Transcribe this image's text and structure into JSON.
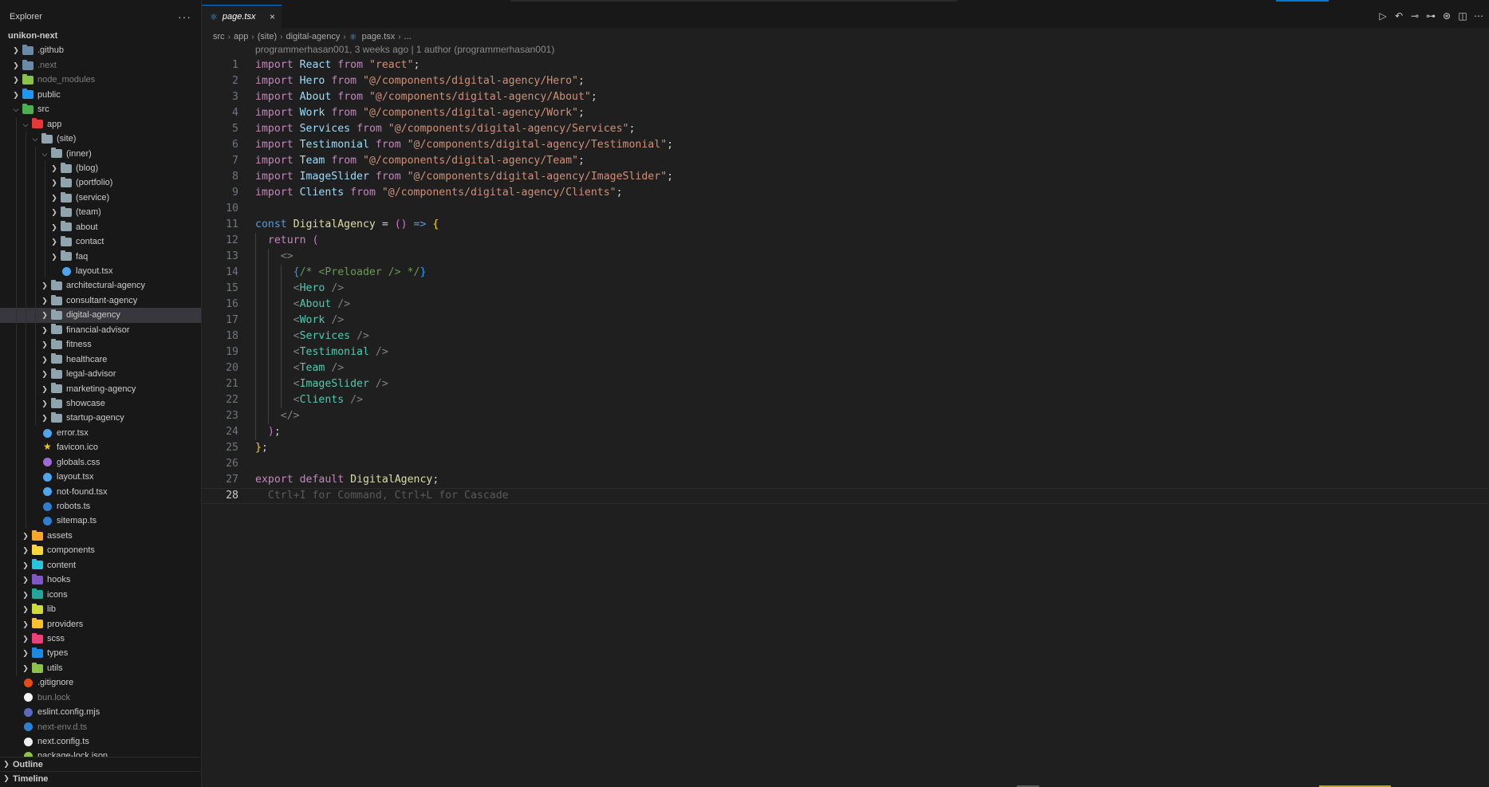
{
  "explorer": {
    "title": "Explorer",
    "more": "···",
    "tree": [
      {
        "label": "unikon-next",
        "depth": 0,
        "type": "root",
        "expanded": true
      },
      {
        "label": ".github",
        "depth": 1,
        "type": "folder",
        "color": "#6b8aa8",
        "expanded": false
      },
      {
        "label": ".next",
        "depth": 1,
        "type": "folder",
        "color": "#6b8aa8",
        "expanded": false,
        "dim": true
      },
      {
        "label": "node_modules",
        "depth": 1,
        "type": "folder",
        "color": "#8bc34a",
        "expanded": false,
        "dim": true
      },
      {
        "label": "public",
        "depth": 1,
        "type": "folder",
        "color": "#2196f3",
        "expanded": false
      },
      {
        "label": "src",
        "depth": 1,
        "type": "folder",
        "color": "#4caf50",
        "expanded": true
      },
      {
        "label": "app",
        "depth": 2,
        "type": "folder",
        "color": "#e53935",
        "expanded": true
      },
      {
        "label": "(site)",
        "depth": 3,
        "type": "folder",
        "color": "#90a4ae",
        "expanded": true
      },
      {
        "label": "(inner)",
        "depth": 4,
        "type": "folder",
        "color": "#90a4ae",
        "expanded": true
      },
      {
        "label": "(blog)",
        "depth": 5,
        "type": "folder",
        "color": "#90a4ae",
        "expanded": false
      },
      {
        "label": "(portfolio)",
        "depth": 5,
        "type": "folder",
        "color": "#90a4ae",
        "expanded": false
      },
      {
        "label": "(service)",
        "depth": 5,
        "type": "folder",
        "color": "#90a4ae",
        "expanded": false
      },
      {
        "label": "(team)",
        "depth": 5,
        "type": "folder",
        "color": "#90a4ae",
        "expanded": false
      },
      {
        "label": "about",
        "depth": 5,
        "type": "folder",
        "color": "#90a4ae",
        "expanded": false
      },
      {
        "label": "contact",
        "depth": 5,
        "type": "folder",
        "color": "#90a4ae",
        "expanded": false
      },
      {
        "label": "faq",
        "depth": 5,
        "type": "folder",
        "color": "#90a4ae",
        "expanded": false
      },
      {
        "label": "layout.tsx",
        "depth": 5,
        "type": "file",
        "color": "#4fa6ed"
      },
      {
        "label": "architectural-agency",
        "depth": 4,
        "type": "folder",
        "color": "#90a4ae",
        "expanded": false
      },
      {
        "label": "consultant-agency",
        "depth": 4,
        "type": "folder",
        "color": "#90a4ae",
        "expanded": false
      },
      {
        "label": "digital-agency",
        "depth": 4,
        "type": "folder",
        "color": "#90a4ae",
        "expanded": false,
        "selected": true
      },
      {
        "label": "financial-advisor",
        "depth": 4,
        "type": "folder",
        "color": "#90a4ae",
        "expanded": false
      },
      {
        "label": "fitness",
        "depth": 4,
        "type": "folder",
        "color": "#90a4ae",
        "expanded": false
      },
      {
        "label": "healthcare",
        "depth": 4,
        "type": "folder",
        "color": "#90a4ae",
        "expanded": false
      },
      {
        "label": "legal-advisor",
        "depth": 4,
        "type": "folder",
        "color": "#90a4ae",
        "expanded": false
      },
      {
        "label": "marketing-agency",
        "depth": 4,
        "type": "folder",
        "color": "#90a4ae",
        "expanded": false
      },
      {
        "label": "showcase",
        "depth": 4,
        "type": "folder",
        "color": "#90a4ae",
        "expanded": false
      },
      {
        "label": "startup-agency",
        "depth": 4,
        "type": "folder",
        "color": "#90a4ae",
        "expanded": false
      },
      {
        "label": "error.tsx",
        "depth": 3,
        "type": "file",
        "color": "#4fa6ed"
      },
      {
        "label": "favicon.ico",
        "depth": 3,
        "type": "star",
        "color": "#f2c511"
      },
      {
        "label": "globals.css",
        "depth": 3,
        "type": "file",
        "color": "#9c6ad6"
      },
      {
        "label": "layout.tsx",
        "depth": 3,
        "type": "file",
        "color": "#4fa6ed"
      },
      {
        "label": "not-found.tsx",
        "depth": 3,
        "type": "file",
        "color": "#4fa6ed"
      },
      {
        "label": "robots.ts",
        "depth": 3,
        "type": "file",
        "color": "#2f7fd1"
      },
      {
        "label": "sitemap.ts",
        "depth": 3,
        "type": "file",
        "color": "#2f7fd1"
      },
      {
        "label": "assets",
        "depth": 2,
        "type": "folder",
        "color": "#f9a825",
        "expanded": false
      },
      {
        "label": "components",
        "depth": 2,
        "type": "folder",
        "color": "#fdd835",
        "expanded": false
      },
      {
        "label": "content",
        "depth": 2,
        "type": "folder",
        "color": "#26c6da",
        "expanded": false
      },
      {
        "label": "hooks",
        "depth": 2,
        "type": "folder",
        "color": "#7e57c2",
        "expanded": false
      },
      {
        "label": "icons",
        "depth": 2,
        "type": "folder",
        "color": "#26a69a",
        "expanded": false
      },
      {
        "label": "lib",
        "depth": 2,
        "type": "folder",
        "color": "#cddc39",
        "expanded": false
      },
      {
        "label": "providers",
        "depth": 2,
        "type": "folder",
        "color": "#fbc02d",
        "expanded": false
      },
      {
        "label": "scss",
        "depth": 2,
        "type": "folder",
        "color": "#ec407a",
        "expanded": false
      },
      {
        "label": "types",
        "depth": 2,
        "type": "folder",
        "color": "#1e88e5",
        "expanded": false
      },
      {
        "label": "utils",
        "depth": 2,
        "type": "folder",
        "color": "#8bc34a",
        "expanded": false
      },
      {
        "label": ".gitignore",
        "depth": 1,
        "type": "file",
        "color": "#e64a19"
      },
      {
        "label": "bun.lock",
        "depth": 1,
        "type": "file",
        "color": "#f5f5f5",
        "dim": true
      },
      {
        "label": "eslint.config.mjs",
        "depth": 1,
        "type": "file",
        "color": "#5c6bc0"
      },
      {
        "label": "next-env.d.ts",
        "depth": 1,
        "type": "file",
        "color": "#2f7fd1",
        "dim": true
      },
      {
        "label": "next.config.ts",
        "depth": 1,
        "type": "file",
        "color": "#eeeeee"
      },
      {
        "label": "package-lock.json",
        "depth": 1,
        "type": "file",
        "color": "#8bc34a"
      }
    ],
    "panels": {
      "outline": "Outline",
      "timeline": "Timeline"
    }
  },
  "tab": {
    "label": "page.tsx",
    "close": "×"
  },
  "breadcrumb": [
    "src",
    "app",
    "(site)",
    "digital-agency",
    "page.tsx",
    "..."
  ],
  "blame": "programmerhasan001, 3 weeks ago | 1 author (programmerhasan001)",
  "code": [
    [
      [
        "kw",
        "import"
      ],
      [
        "pun",
        " "
      ],
      [
        "id",
        "React"
      ],
      [
        "pun",
        " "
      ],
      [
        "kw",
        "from"
      ],
      [
        "pun",
        " "
      ],
      [
        "str",
        "\"react\""
      ],
      [
        "pun",
        ";"
      ]
    ],
    [
      [
        "kw",
        "import"
      ],
      [
        "pun",
        " "
      ],
      [
        "id",
        "Hero"
      ],
      [
        "pun",
        " "
      ],
      [
        "kw",
        "from"
      ],
      [
        "pun",
        " "
      ],
      [
        "str",
        "\"@/components/digital-agency/Hero\""
      ],
      [
        "pun",
        ";"
      ]
    ],
    [
      [
        "kw",
        "import"
      ],
      [
        "pun",
        " "
      ],
      [
        "id",
        "About"
      ],
      [
        "pun",
        " "
      ],
      [
        "kw",
        "from"
      ],
      [
        "pun",
        " "
      ],
      [
        "str",
        "\"@/components/digital-agency/About\""
      ],
      [
        "pun",
        ";"
      ]
    ],
    [
      [
        "kw",
        "import"
      ],
      [
        "pun",
        " "
      ],
      [
        "id",
        "Work"
      ],
      [
        "pun",
        " "
      ],
      [
        "kw",
        "from"
      ],
      [
        "pun",
        " "
      ],
      [
        "str",
        "\"@/components/digital-agency/Work\""
      ],
      [
        "pun",
        ";"
      ]
    ],
    [
      [
        "kw",
        "import"
      ],
      [
        "pun",
        " "
      ],
      [
        "id",
        "Services"
      ],
      [
        "pun",
        " "
      ],
      [
        "kw",
        "from"
      ],
      [
        "pun",
        " "
      ],
      [
        "str",
        "\"@/components/digital-agency/Services\""
      ],
      [
        "pun",
        ";"
      ]
    ],
    [
      [
        "kw",
        "import"
      ],
      [
        "pun",
        " "
      ],
      [
        "id",
        "Testimonial"
      ],
      [
        "pun",
        " "
      ],
      [
        "kw",
        "from"
      ],
      [
        "pun",
        " "
      ],
      [
        "str",
        "\"@/components/digital-agency/Testimonial\""
      ],
      [
        "pun",
        ";"
      ]
    ],
    [
      [
        "kw",
        "import"
      ],
      [
        "pun",
        " "
      ],
      [
        "id",
        "Team"
      ],
      [
        "pun",
        " "
      ],
      [
        "kw",
        "from"
      ],
      [
        "pun",
        " "
      ],
      [
        "str",
        "\"@/components/digital-agency/Team\""
      ],
      [
        "pun",
        ";"
      ]
    ],
    [
      [
        "kw",
        "import"
      ],
      [
        "pun",
        " "
      ],
      [
        "id",
        "ImageSlider"
      ],
      [
        "pun",
        " "
      ],
      [
        "kw",
        "from"
      ],
      [
        "pun",
        " "
      ],
      [
        "str",
        "\"@/components/digital-agency/ImageSlider\""
      ],
      [
        "pun",
        ";"
      ]
    ],
    [
      [
        "kw",
        "import"
      ],
      [
        "pun",
        " "
      ],
      [
        "id",
        "Clients"
      ],
      [
        "pun",
        " "
      ],
      [
        "kw",
        "from"
      ],
      [
        "pun",
        " "
      ],
      [
        "str",
        "\"@/components/digital-agency/Clients\""
      ],
      [
        "pun",
        ";"
      ]
    ],
    [],
    [
      [
        "kwb",
        "const"
      ],
      [
        "pun",
        " "
      ],
      [
        "fn",
        "DigitalAgency"
      ],
      [
        "pun",
        " = "
      ],
      [
        "br2",
        "()"
      ],
      [
        "pun",
        " "
      ],
      [
        "kwb",
        "=>"
      ],
      [
        "pun",
        " "
      ],
      [
        "br1",
        "{"
      ]
    ],
    [
      [
        "pun",
        "  "
      ],
      [
        "kw",
        "return"
      ],
      [
        "pun",
        " "
      ],
      [
        "br2",
        "("
      ]
    ],
    [
      [
        "pun",
        "    "
      ],
      [
        "tagp",
        "<>"
      ]
    ],
    [
      [
        "pun",
        "      "
      ],
      [
        "br3",
        "{"
      ],
      [
        "cmt",
        "/* <Preloader /> */"
      ],
      [
        "br3",
        "}"
      ]
    ],
    [
      [
        "pun",
        "      "
      ],
      [
        "tagp",
        "<"
      ],
      [
        "tag",
        "Hero"
      ],
      [
        "pun",
        " "
      ],
      [
        "tagp",
        "/>"
      ]
    ],
    [
      [
        "pun",
        "      "
      ],
      [
        "tagp",
        "<"
      ],
      [
        "tag",
        "About"
      ],
      [
        "pun",
        " "
      ],
      [
        "tagp",
        "/>"
      ]
    ],
    [
      [
        "pun",
        "      "
      ],
      [
        "tagp",
        "<"
      ],
      [
        "tag",
        "Work"
      ],
      [
        "pun",
        " "
      ],
      [
        "tagp",
        "/>"
      ]
    ],
    [
      [
        "pun",
        "      "
      ],
      [
        "tagp",
        "<"
      ],
      [
        "tag",
        "Services"
      ],
      [
        "pun",
        " "
      ],
      [
        "tagp",
        "/>"
      ]
    ],
    [
      [
        "pun",
        "      "
      ],
      [
        "tagp",
        "<"
      ],
      [
        "tag",
        "Testimonial"
      ],
      [
        "pun",
        " "
      ],
      [
        "tagp",
        "/>"
      ]
    ],
    [
      [
        "pun",
        "      "
      ],
      [
        "tagp",
        "<"
      ],
      [
        "tag",
        "Team"
      ],
      [
        "pun",
        " "
      ],
      [
        "tagp",
        "/>"
      ]
    ],
    [
      [
        "pun",
        "      "
      ],
      [
        "tagp",
        "<"
      ],
      [
        "tag",
        "ImageSlider"
      ],
      [
        "pun",
        " "
      ],
      [
        "tagp",
        "/>"
      ]
    ],
    [
      [
        "pun",
        "      "
      ],
      [
        "tagp",
        "<"
      ],
      [
        "tag",
        "Clients"
      ],
      [
        "pun",
        " "
      ],
      [
        "tagp",
        "/>"
      ]
    ],
    [
      [
        "pun",
        "    "
      ],
      [
        "tagp",
        "</>"
      ]
    ],
    [
      [
        "pun",
        "  "
      ],
      [
        "br2",
        ")"
      ],
      [
        "pun",
        ";"
      ]
    ],
    [
      [
        "br1",
        "}"
      ],
      [
        "pun",
        ";"
      ]
    ],
    [],
    [
      [
        "kw",
        "export"
      ],
      [
        "pun",
        " "
      ],
      [
        "kw",
        "default"
      ],
      [
        "pun",
        " "
      ],
      [
        "fn",
        "DigitalAgency"
      ],
      [
        "pun",
        ";"
      ]
    ],
    [
      [
        "pun",
        "  "
      ],
      [
        "hint",
        "Ctrl+I for Command, Ctrl+L for Cascade"
      ]
    ]
  ],
  "current_line": 28,
  "toolbar": [
    {
      "name": "run-icon",
      "glyph": "▷"
    },
    {
      "name": "git-back-icon",
      "glyph": "↶"
    },
    {
      "name": "git-commit-icon",
      "glyph": "⊸"
    },
    {
      "name": "git-forward-icon",
      "glyph": "⊶"
    },
    {
      "name": "git-compare-icon",
      "glyph": "⊛"
    },
    {
      "name": "split-editor-icon",
      "glyph": "◫"
    },
    {
      "name": "more-actions-icon",
      "glyph": "⋯"
    }
  ]
}
